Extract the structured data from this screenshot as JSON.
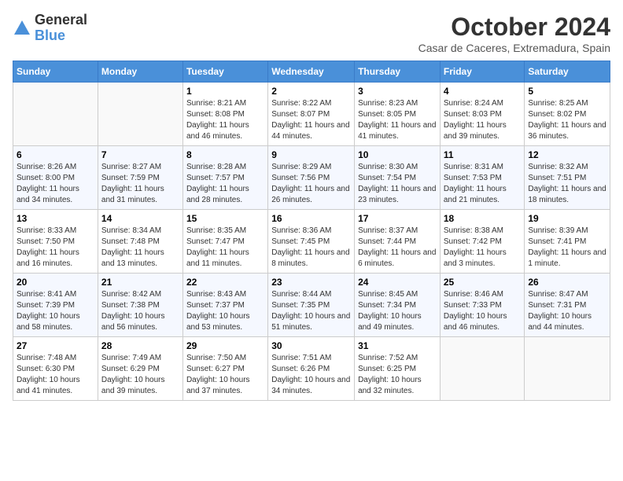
{
  "logo": {
    "general": "General",
    "blue": "Blue"
  },
  "title": "October 2024",
  "subtitle": "Casar de Caceres, Extremadura, Spain",
  "days_of_week": [
    "Sunday",
    "Monday",
    "Tuesday",
    "Wednesday",
    "Thursday",
    "Friday",
    "Saturday"
  ],
  "weeks": [
    [
      {
        "day": "",
        "info": ""
      },
      {
        "day": "",
        "info": ""
      },
      {
        "day": "1",
        "sunrise": "Sunrise: 8:21 AM",
        "sunset": "Sunset: 8:08 PM",
        "daylight": "Daylight: 11 hours and 46 minutes."
      },
      {
        "day": "2",
        "sunrise": "Sunrise: 8:22 AM",
        "sunset": "Sunset: 8:07 PM",
        "daylight": "Daylight: 11 hours and 44 minutes."
      },
      {
        "day": "3",
        "sunrise": "Sunrise: 8:23 AM",
        "sunset": "Sunset: 8:05 PM",
        "daylight": "Daylight: 11 hours and 41 minutes."
      },
      {
        "day": "4",
        "sunrise": "Sunrise: 8:24 AM",
        "sunset": "Sunset: 8:03 PM",
        "daylight": "Daylight: 11 hours and 39 minutes."
      },
      {
        "day": "5",
        "sunrise": "Sunrise: 8:25 AM",
        "sunset": "Sunset: 8:02 PM",
        "daylight": "Daylight: 11 hours and 36 minutes."
      }
    ],
    [
      {
        "day": "6",
        "sunrise": "Sunrise: 8:26 AM",
        "sunset": "Sunset: 8:00 PM",
        "daylight": "Daylight: 11 hours and 34 minutes."
      },
      {
        "day": "7",
        "sunrise": "Sunrise: 8:27 AM",
        "sunset": "Sunset: 7:59 PM",
        "daylight": "Daylight: 11 hours and 31 minutes."
      },
      {
        "day": "8",
        "sunrise": "Sunrise: 8:28 AM",
        "sunset": "Sunset: 7:57 PM",
        "daylight": "Daylight: 11 hours and 28 minutes."
      },
      {
        "day": "9",
        "sunrise": "Sunrise: 8:29 AM",
        "sunset": "Sunset: 7:56 PM",
        "daylight": "Daylight: 11 hours and 26 minutes."
      },
      {
        "day": "10",
        "sunrise": "Sunrise: 8:30 AM",
        "sunset": "Sunset: 7:54 PM",
        "daylight": "Daylight: 11 hours and 23 minutes."
      },
      {
        "day": "11",
        "sunrise": "Sunrise: 8:31 AM",
        "sunset": "Sunset: 7:53 PM",
        "daylight": "Daylight: 11 hours and 21 minutes."
      },
      {
        "day": "12",
        "sunrise": "Sunrise: 8:32 AM",
        "sunset": "Sunset: 7:51 PM",
        "daylight": "Daylight: 11 hours and 18 minutes."
      }
    ],
    [
      {
        "day": "13",
        "sunrise": "Sunrise: 8:33 AM",
        "sunset": "Sunset: 7:50 PM",
        "daylight": "Daylight: 11 hours and 16 minutes."
      },
      {
        "day": "14",
        "sunrise": "Sunrise: 8:34 AM",
        "sunset": "Sunset: 7:48 PM",
        "daylight": "Daylight: 11 hours and 13 minutes."
      },
      {
        "day": "15",
        "sunrise": "Sunrise: 8:35 AM",
        "sunset": "Sunset: 7:47 PM",
        "daylight": "Daylight: 11 hours and 11 minutes."
      },
      {
        "day": "16",
        "sunrise": "Sunrise: 8:36 AM",
        "sunset": "Sunset: 7:45 PM",
        "daylight": "Daylight: 11 hours and 8 minutes."
      },
      {
        "day": "17",
        "sunrise": "Sunrise: 8:37 AM",
        "sunset": "Sunset: 7:44 PM",
        "daylight": "Daylight: 11 hours and 6 minutes."
      },
      {
        "day": "18",
        "sunrise": "Sunrise: 8:38 AM",
        "sunset": "Sunset: 7:42 PM",
        "daylight": "Daylight: 11 hours and 3 minutes."
      },
      {
        "day": "19",
        "sunrise": "Sunrise: 8:39 AM",
        "sunset": "Sunset: 7:41 PM",
        "daylight": "Daylight: 11 hours and 1 minute."
      }
    ],
    [
      {
        "day": "20",
        "sunrise": "Sunrise: 8:41 AM",
        "sunset": "Sunset: 7:39 PM",
        "daylight": "Daylight: 10 hours and 58 minutes."
      },
      {
        "day": "21",
        "sunrise": "Sunrise: 8:42 AM",
        "sunset": "Sunset: 7:38 PM",
        "daylight": "Daylight: 10 hours and 56 minutes."
      },
      {
        "day": "22",
        "sunrise": "Sunrise: 8:43 AM",
        "sunset": "Sunset: 7:37 PM",
        "daylight": "Daylight: 10 hours and 53 minutes."
      },
      {
        "day": "23",
        "sunrise": "Sunrise: 8:44 AM",
        "sunset": "Sunset: 7:35 PM",
        "daylight": "Daylight: 10 hours and 51 minutes."
      },
      {
        "day": "24",
        "sunrise": "Sunrise: 8:45 AM",
        "sunset": "Sunset: 7:34 PM",
        "daylight": "Daylight: 10 hours and 49 minutes."
      },
      {
        "day": "25",
        "sunrise": "Sunrise: 8:46 AM",
        "sunset": "Sunset: 7:33 PM",
        "daylight": "Daylight: 10 hours and 46 minutes."
      },
      {
        "day": "26",
        "sunrise": "Sunrise: 8:47 AM",
        "sunset": "Sunset: 7:31 PM",
        "daylight": "Daylight: 10 hours and 44 minutes."
      }
    ],
    [
      {
        "day": "27",
        "sunrise": "Sunrise: 7:48 AM",
        "sunset": "Sunset: 6:30 PM",
        "daylight": "Daylight: 10 hours and 41 minutes."
      },
      {
        "day": "28",
        "sunrise": "Sunrise: 7:49 AM",
        "sunset": "Sunset: 6:29 PM",
        "daylight": "Daylight: 10 hours and 39 minutes."
      },
      {
        "day": "29",
        "sunrise": "Sunrise: 7:50 AM",
        "sunset": "Sunset: 6:27 PM",
        "daylight": "Daylight: 10 hours and 37 minutes."
      },
      {
        "day": "30",
        "sunrise": "Sunrise: 7:51 AM",
        "sunset": "Sunset: 6:26 PM",
        "daylight": "Daylight: 10 hours and 34 minutes."
      },
      {
        "day": "31",
        "sunrise": "Sunrise: 7:52 AM",
        "sunset": "Sunset: 6:25 PM",
        "daylight": "Daylight: 10 hours and 32 minutes."
      },
      {
        "day": "",
        "info": ""
      },
      {
        "day": "",
        "info": ""
      }
    ]
  ]
}
